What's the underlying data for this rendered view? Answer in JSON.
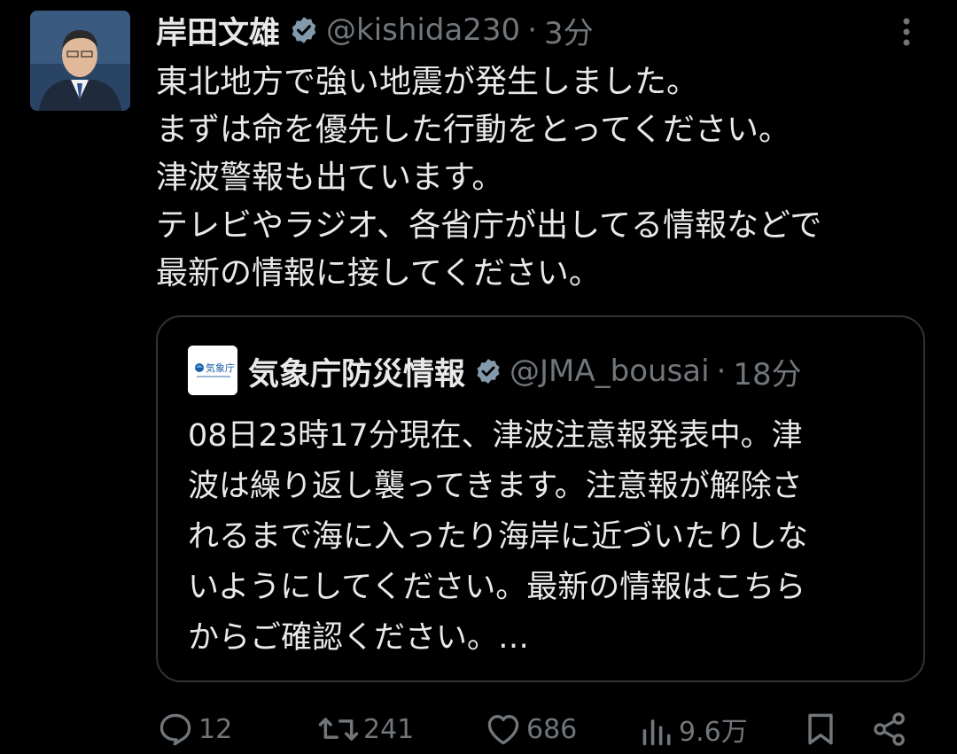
{
  "tweet": {
    "author_name": "岸田文雄",
    "handle": "@kishida230",
    "separator": "·",
    "time": "3分",
    "lines": [
      "東北地方で強い地震が発生しました。",
      "まずは命を優先した行動をとってください。",
      "津波警報も出ています。",
      "テレビやラジオ、各省庁が出してる情報などで",
      "最新の情報に接してください。"
    ]
  },
  "quote": {
    "author_name": "気象庁防災情報",
    "handle": "@JMA_bousai",
    "separator": "·",
    "time": "18分",
    "logo_text": "気象庁",
    "lines": [
      "08日23時17分現在、津波注意報発表中。津",
      "波は繰り返し襲ってきます。注意報が解除さ",
      "れるまで海に入ったり海岸に近づいたりしな",
      "いようにしてください。最新の情報はこちら",
      "からご確認ください。…"
    ]
  },
  "actions": {
    "replies": "12",
    "retweets": "241",
    "likes": "686",
    "views": "9.6万"
  },
  "colors": {
    "background": "#000000",
    "text": "#e7e9ea",
    "muted": "#71767b",
    "verified": "#829aab",
    "border": "#2f3336"
  }
}
